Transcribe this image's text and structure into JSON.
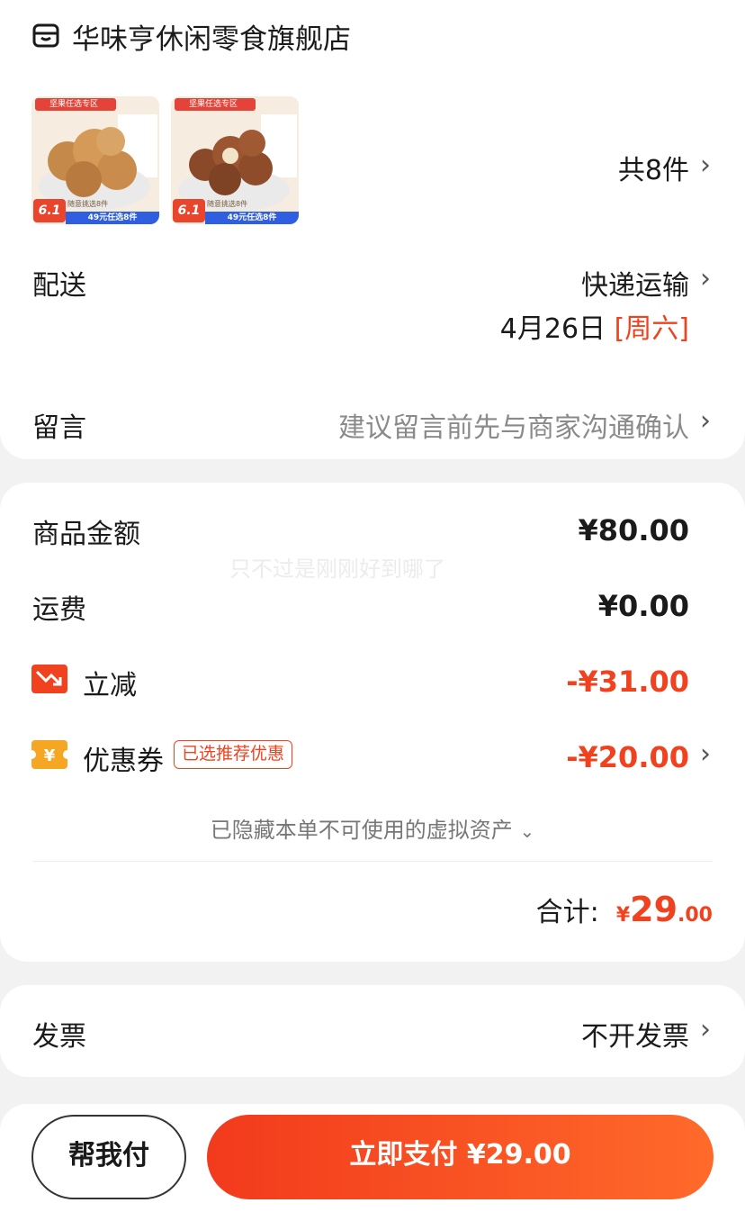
{
  "store": {
    "name": "华味亨休闲零食旗舰店",
    "icon": "store-icon"
  },
  "products": {
    "count_label": "共8件",
    "items": [
      {
        "zone_tag": "坚果任选专区",
        "promo_badge": "6.1",
        "promo_bar": "49元任选8件",
        "promo_sub": "随意挑选8件"
      },
      {
        "zone_tag": "坚果任选专区",
        "promo_badge": "6.1",
        "promo_bar": "49元任选8件",
        "promo_sub": "随意挑选8件"
      }
    ]
  },
  "delivery": {
    "label": "配送",
    "method": "快递运输",
    "date": "4月26日",
    "weekday": "[周六]"
  },
  "message": {
    "label": "留言",
    "placeholder": "建议留言前先与商家沟通确认"
  },
  "summary": {
    "goods_label": "商品金额",
    "goods_value": "¥80.00",
    "watermark": "只不过是刚刚好到哪了",
    "shipping_label": "运费",
    "shipping_value": "¥0.00",
    "discount_label": "立减",
    "discount_value": "-¥31.00",
    "coupon_label": "优惠券",
    "coupon_tag": "已选推荐优惠",
    "coupon_value": "-¥20.00",
    "hidden_assets": "已隐藏本单不可使用的虚拟资产",
    "total_label": "合计:",
    "total_currency": "¥",
    "total_int": "29",
    "total_dec": ".00"
  },
  "invoice": {
    "label": "发票",
    "value": "不开发票"
  },
  "footer": {
    "help_pay": "帮我付",
    "pay_now": "立即支付 ¥29.00"
  },
  "colors": {
    "accent_red": "#f0421f",
    "pay_gradient_start": "#f23a1c",
    "pay_gradient_end": "#ff6a2a"
  },
  "icons": {
    "chevron": "chevron-right-icon",
    "discount": "price-down-icon",
    "coupon": "yen-coupon-icon"
  }
}
